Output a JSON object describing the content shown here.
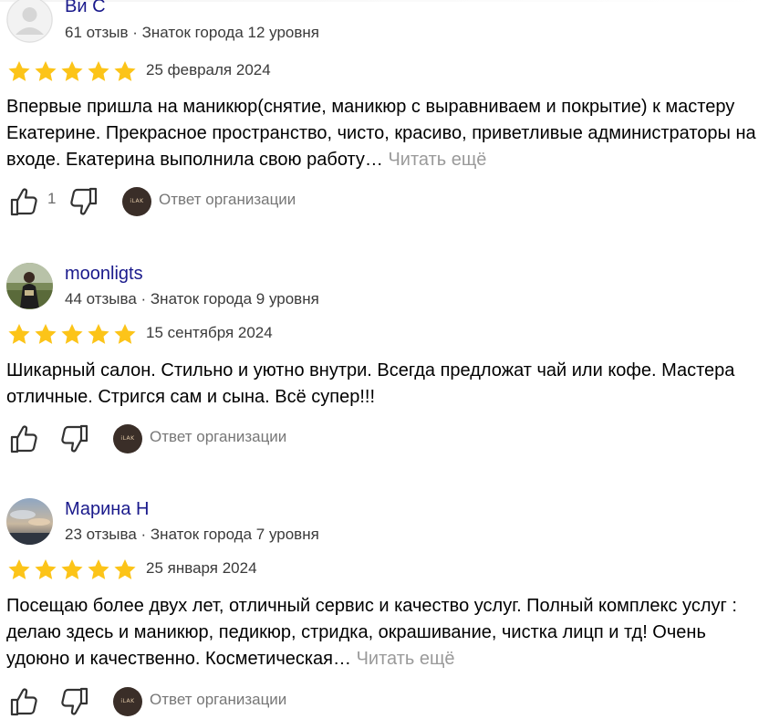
{
  "reviews": [
    {
      "author": "Ви С",
      "meta": "61 отзыв · Знаток города 12 уровня",
      "rating": 5,
      "date": "25 февраля 2024",
      "text": "Впервые пришла на маникюр(снятие, маникюр с выравниваем и покрытие) к мастеру Екатерине. Прекрасное пространство, чисто, красиво, приветливые администраторы на входе. Екатерина выполнила свою работу…",
      "read_more": "Читать ещё",
      "likes": "1",
      "org_reply_label": "Ответ организации",
      "org_logo_text": "iLAK"
    },
    {
      "author": "moonligts",
      "meta": "44 отзыва · Знаток города 9 уровня",
      "rating": 5,
      "date": "15 сентября 2024",
      "text": "Шикарный салон. Стильно и уютно внутри. Всегда предложат чай или кофе. Мастера отличные. Стригся сам и сына. Всё супер!!!",
      "org_reply_label": "Ответ организации",
      "org_logo_text": "iLAK"
    },
    {
      "author": "Марина Н",
      "meta": "23 отзыва · Знаток города 7 уровня",
      "rating": 5,
      "date": "25 января 2024",
      "text": "Посещаю более двух лет, отличный сервис и качество услуг. Полный комплекс услуг : делаю здесь и маникюр, педикюр, стридка, окрашивание, чистка лицп и тд! Очень удоюно и качественно. Косметическая…",
      "read_more": "Читать ещё",
      "org_reply_label": "Ответ организации",
      "org_logo_text": "iLAK"
    }
  ],
  "colors": {
    "author_name": "#1a1a8c",
    "star": "#fcc419",
    "muted_text": "#9a9a9a",
    "org_logo_bg": "#3a2e28"
  },
  "icons": {
    "like": "thumbs-up-icon",
    "dislike": "thumbs-down-icon",
    "star": "star-icon"
  }
}
